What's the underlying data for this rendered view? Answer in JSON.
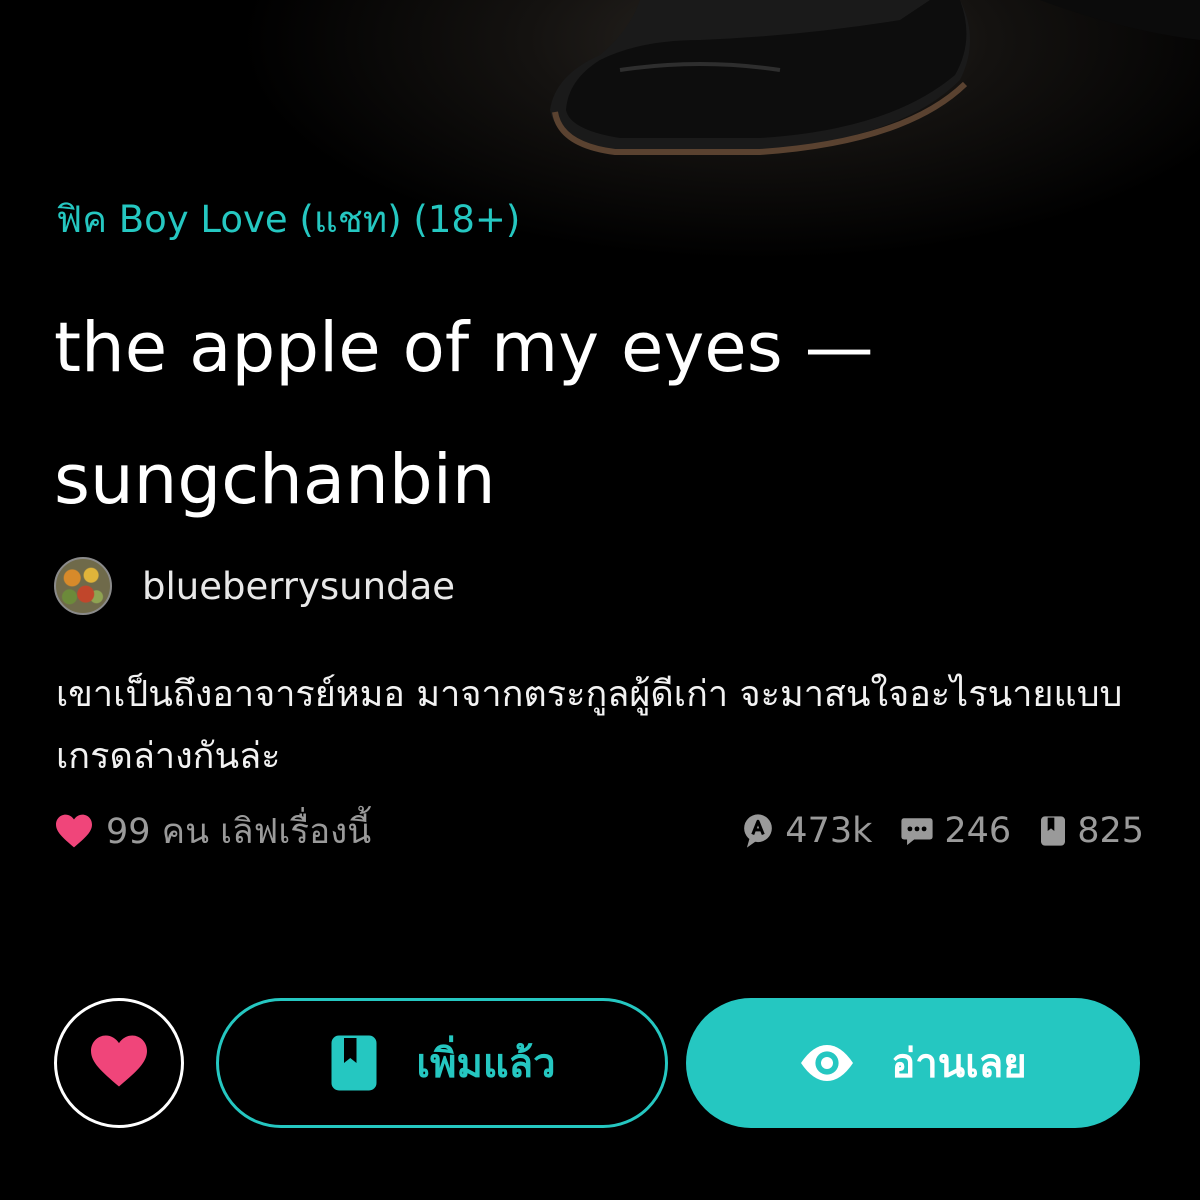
{
  "colors": {
    "accent": "#25c7c1",
    "heart": "#f0457a",
    "muted": "#9a9a9a",
    "background": "#000000"
  },
  "story": {
    "category": "ฟิค Boy Love (แชท) (18+)",
    "title": "the apple of my eyes — sungchanbin",
    "author": "blueberrysundae",
    "description": "เขาเป็นถึงอาจารย์หมอ มาจากตระกูลผู้ดีเก่า จะมาสนใจอะไรนายแบบเกรดล่างกันล่ะ",
    "loves_text": "99 คน เลิฟเรื่องนี้"
  },
  "stats": {
    "reads": "473k",
    "comments": "246",
    "bookmarks": "825"
  },
  "actions": {
    "added_label": "เพิ่มแล้ว",
    "read_label": "อ่านเลย"
  },
  "icons": {
    "loves": "heart-icon",
    "reads": "read-count-icon",
    "comments": "comment-icon",
    "bookmarks": "bookmark-icon",
    "added": "bookmark-icon",
    "read": "eye-icon"
  }
}
